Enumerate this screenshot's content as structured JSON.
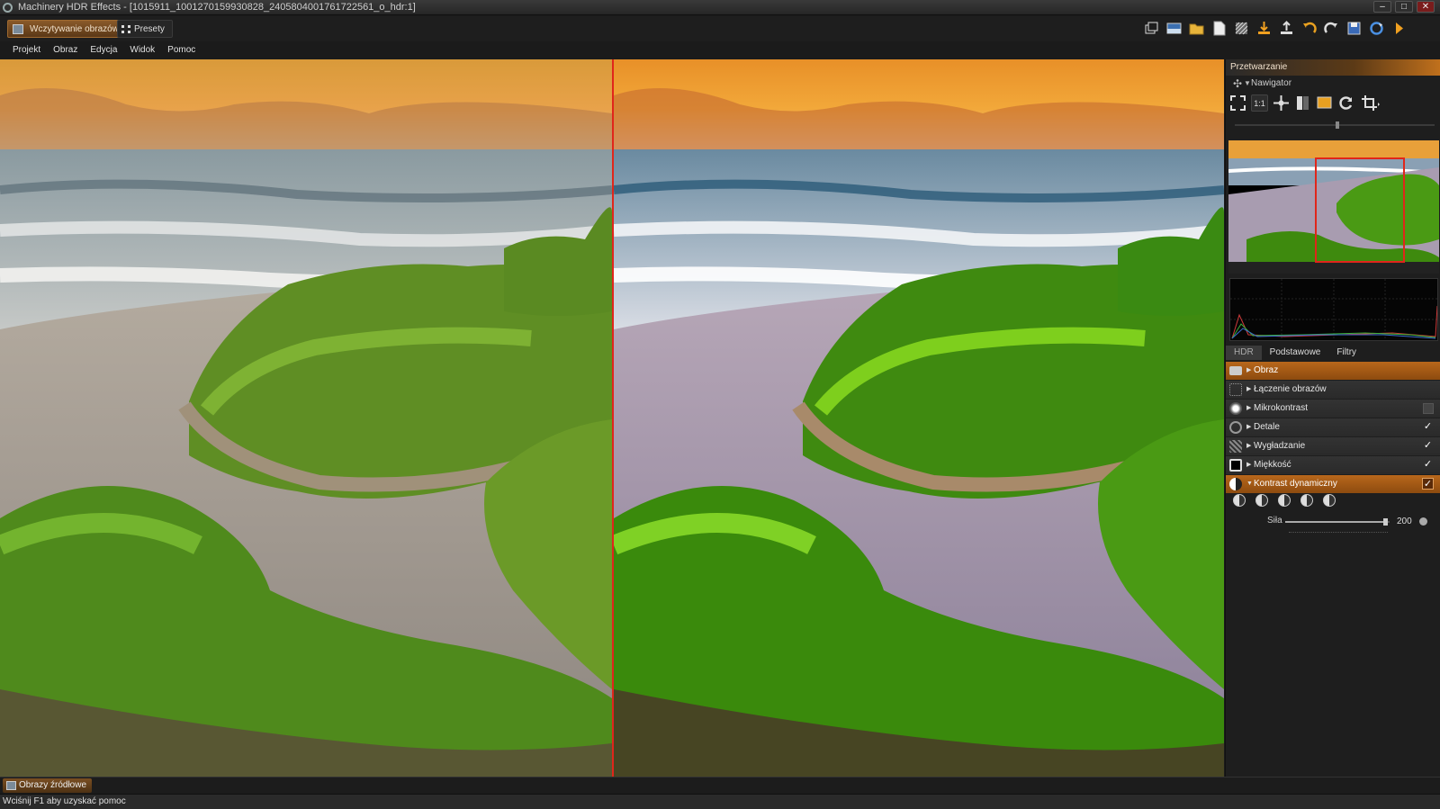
{
  "window": {
    "title": "Machinery HDR Effects - [1015911_1001270159930828_2405804001761722561_o_hdr:1]",
    "controls": [
      "–",
      "□",
      "✕"
    ]
  },
  "toolbar": {
    "load_tab": "Wczytywanie obrazów",
    "presets_tab": "Presety",
    "icons": [
      "windows-icon",
      "panorama-icon",
      "folder-icon",
      "document-icon",
      "pattern-icon",
      "import-icon",
      "export-icon",
      "undo-icon",
      "redo-icon",
      "save-icon",
      "process-icon",
      "play-icon"
    ]
  },
  "menu": {
    "items": [
      "Projekt",
      "Obraz",
      "Edycja",
      "Widok",
      "Pomoc"
    ]
  },
  "right_panel": {
    "header": "Przetwarzanie",
    "navigator": {
      "label": "Nawigator",
      "zoom_label": "1:1"
    },
    "tabs": [
      "HDR",
      "Podstawowe",
      "Filtry"
    ],
    "rows": [
      {
        "label": "Obraz",
        "checked": null,
        "expanded": false
      },
      {
        "label": "Łączenie obrazów",
        "checked": null,
        "expanded": false
      },
      {
        "label": "Mikrokontrast",
        "checked": false,
        "expanded": false
      },
      {
        "label": "Detale",
        "checked": true,
        "expanded": false
      },
      {
        "label": "Wygładzanie",
        "checked": true,
        "expanded": false
      },
      {
        "label": "Miękkość",
        "checked": true,
        "expanded": false
      },
      {
        "label": "Kontrast dynamiczny",
        "checked": true,
        "expanded": true
      }
    ],
    "sila": {
      "label": "Siła",
      "value": "200",
      "level": 0.96
    }
  },
  "bottom": {
    "source_tab": "Obrazy źródłowe",
    "status": "Wciśnij F1 aby uzyskać pomoc"
  },
  "colors": {
    "accent": "#c0701c",
    "divider": "#e0261b"
  }
}
